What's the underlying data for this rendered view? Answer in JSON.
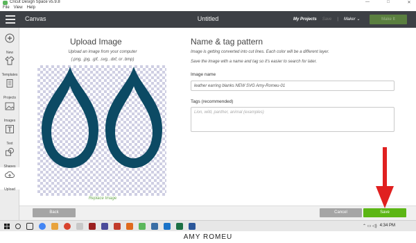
{
  "window": {
    "app_title": "Cricut Design Space  v5.9.8",
    "controls": [
      "—",
      "□",
      "✕"
    ]
  },
  "menu": {
    "items": [
      "File",
      "View",
      "Help"
    ]
  },
  "header": {
    "brand": "Canvas",
    "doc_title": "Untitled",
    "my_projects": "My Projects",
    "save": "Save",
    "separator": "|",
    "machine": "Maker",
    "make_it": "Make It"
  },
  "toolbar": {
    "items": [
      {
        "label": "New",
        "icon": "plus-icon"
      },
      {
        "label": "Templates",
        "icon": "shirt-icon"
      },
      {
        "label": "Projects",
        "icon": "projects-icon"
      },
      {
        "label": "Images",
        "icon": "images-icon"
      },
      {
        "label": "Text",
        "icon": "text-icon"
      },
      {
        "label": "Shapes",
        "icon": "shapes-icon"
      },
      {
        "label": "Upload",
        "icon": "upload-icon"
      }
    ]
  },
  "upload": {
    "title": "Upload Image",
    "subtitle": "Upload an image from your computer",
    "types": "(.png, .jpg, .gif, .svg, .dxf, or .bmp)",
    "replace": "Replace Image",
    "shape_color": "#0c4a64"
  },
  "tagging": {
    "title": "Name & tag pattern",
    "desc1": "Image is getting converted into cut lines. Each color will be a different layer.",
    "desc2": "Save the image with a name and tag so it's easier to search for later.",
    "name_label": "Image name",
    "name_value": "leather earring blanks NEW SVG Amy-Romeu-01",
    "tags_label": "Tags (recommended)",
    "tags_placeholder": "Lion, wild, panther, animal (examples)"
  },
  "footer": {
    "back": "Back",
    "cancel": "Cancel",
    "save": "Save"
  },
  "taskbar": {
    "time": "4:34 PM"
  },
  "caption": "AMY ROMEU",
  "colors": {
    "header_bg": "#3d4045",
    "save_green": "#5cb615",
    "arrow_red": "#e02020"
  }
}
